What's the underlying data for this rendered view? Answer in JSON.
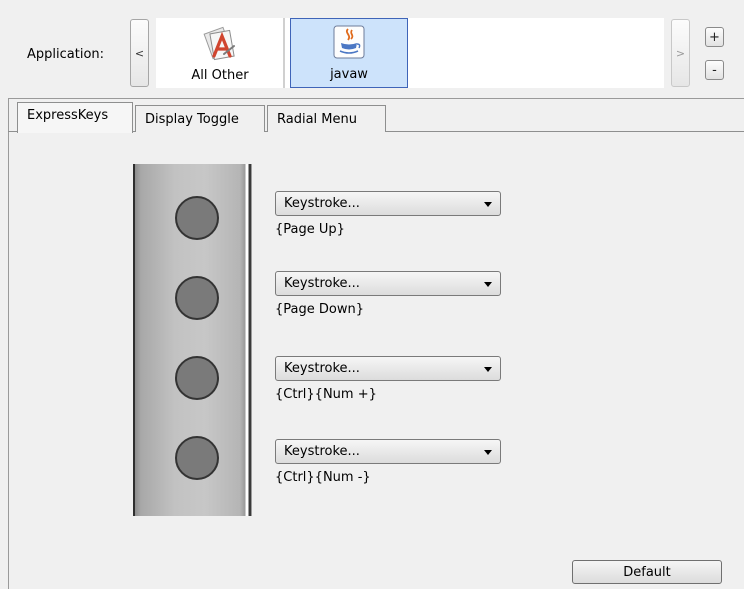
{
  "application": {
    "label": "Application:",
    "nav_prev": "<",
    "nav_next": ">",
    "add": "+",
    "remove": "-",
    "tiles": [
      {
        "label": "All Other",
        "icon": "applications-icon",
        "selected": false
      },
      {
        "label": "javaw",
        "icon": "java-icon",
        "selected": true
      }
    ]
  },
  "tabs": [
    {
      "label": "ExpressKeys",
      "active": true
    },
    {
      "label": "Display Toggle",
      "active": false
    },
    {
      "label": "Radial Menu",
      "active": false
    }
  ],
  "expresskeys": [
    {
      "action": "Keystroke...",
      "value": "{Page Up}"
    },
    {
      "action": "Keystroke...",
      "value": "{Page Down}"
    },
    {
      "action": "Keystroke...",
      "value": "{Ctrl}{Num +}"
    },
    {
      "action": "Keystroke...",
      "value": "{Ctrl}{Num -}"
    }
  ],
  "default_button": "Default",
  "colors": {
    "selected_tile_bg": "#cde3fb",
    "selected_tile_border": "#3f64b8",
    "window_bg": "#f0f0f0"
  }
}
